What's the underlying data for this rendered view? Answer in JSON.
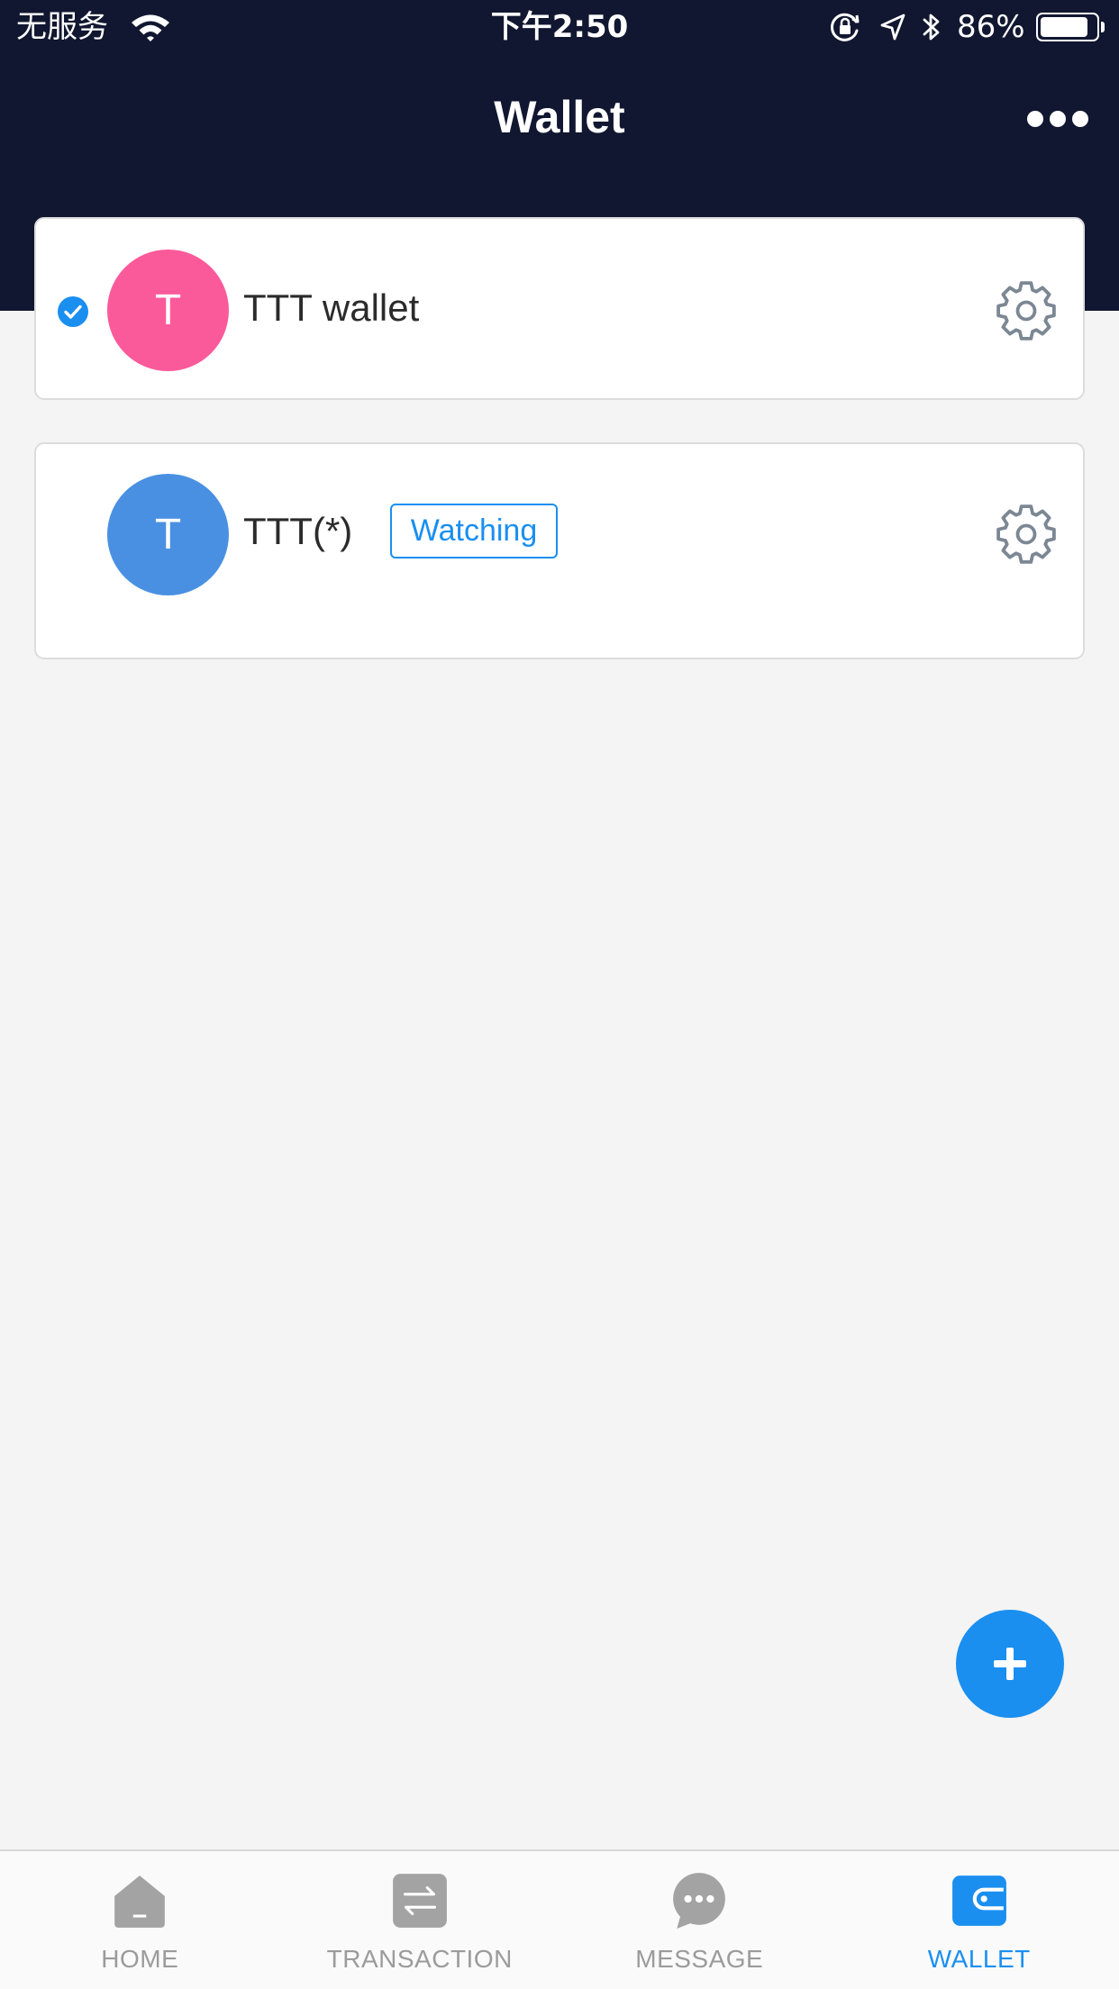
{
  "status_bar": {
    "carrier": "无服务",
    "time": "下午2:50",
    "battery_percent": "86%",
    "battery_level": 0.86,
    "icons": [
      "wifi-icon",
      "orientation-lock-icon",
      "location-arrow-icon",
      "bluetooth-icon",
      "battery-icon"
    ]
  },
  "header": {
    "title": "Wallet",
    "menu_icon": "more-icon"
  },
  "wallets": [
    {
      "name": "TTT wallet",
      "initial": "T",
      "avatar_color": "#fb5a9a",
      "selected": true,
      "badge": "",
      "settings_icon": "gear-icon"
    },
    {
      "name": "TTT(*)",
      "initial": "T",
      "avatar_color": "#4a90e2",
      "selected": false,
      "badge": "Watching",
      "settings_icon": "gear-icon"
    }
  ],
  "fab": {
    "icon": "plus-icon"
  },
  "tab_bar": {
    "tabs": [
      {
        "label": "HOME",
        "icon": "home-icon",
        "active": false
      },
      {
        "label": "TRANSACTION",
        "icon": "transfer-icon",
        "active": false
      },
      {
        "label": "MESSAGE",
        "icon": "message-icon",
        "active": false
      },
      {
        "label": "WALLET",
        "icon": "wallet-icon",
        "active": true
      }
    ]
  },
  "colors": {
    "header_bg": "#111730",
    "accent": "#1a8ff0",
    "tab_inactive": "#9b9b9b",
    "tab_icon": "#a3a3a3",
    "gear": "#7c8794",
    "background": "#f4f4f4"
  }
}
